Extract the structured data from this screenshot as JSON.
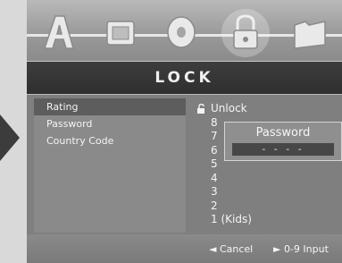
{
  "tabs": [
    {
      "name": "Audio",
      "glyph": "A"
    },
    {
      "name": "Picture",
      "glyph": "▣"
    },
    {
      "name": "Disc",
      "glyph": "◎"
    },
    {
      "name": "Lock",
      "glyph": "🔒"
    },
    {
      "name": "Folder",
      "glyph": "📁"
    }
  ],
  "title": "LOCK",
  "menu": {
    "items": [
      "Rating",
      "Password",
      "Country Code"
    ],
    "selected_index": 0
  },
  "ratings": {
    "unlock_label": "Unlock",
    "levels": [
      "8",
      "7",
      "6",
      "5",
      "4",
      "3",
      "2",
      "1 (Kids)"
    ]
  },
  "password_dialog": {
    "title": "Password",
    "mask": "- - - -"
  },
  "hints": {
    "cancel": "◄ Cancel",
    "input": "► 0-9 Input"
  }
}
